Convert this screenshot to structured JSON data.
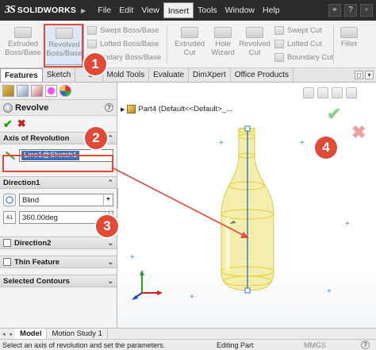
{
  "app": {
    "brand": "SOLIDWORKS",
    "brand_mark": "3S",
    "menus": [
      "File",
      "Edit",
      "View",
      "Insert",
      "Tools",
      "Window",
      "Help"
    ],
    "active_menu": "Insert",
    "help_glyph": "?",
    "window_glyph": "▫"
  },
  "ribbon": {
    "extruded_boss": "Extruded\nBoss/Base",
    "revolved_boss": "Revolved\nBoss/Base",
    "swept_boss": "Swept Boss/Base",
    "lofted_boss": "Lofted Boss/Base",
    "boundary_boss": "undary Boss/Base",
    "extruded_cut": "Extruded\nCut",
    "hole_wizard": "Hole\nWizard",
    "revolved_cut": "Revolved\nCut",
    "swept_cut": "Swept Cut",
    "lofted_cut": "Lofted Cut",
    "boundary_cut": "Boundary Cut",
    "fillet": "Fillet"
  },
  "tabs": [
    "Features",
    "Sketch",
    "Su",
    "Mold Tools",
    "Evaluate",
    "DimXpert",
    "Office Products"
  ],
  "active_tab": "Features",
  "property_manager": {
    "title": "Revolve",
    "axis_group": "Axis of Revolution",
    "axis_value": "Line1@Sketch1",
    "direction1_group": "Direction1",
    "end_condition": "Blind",
    "angle_value": "360.00deg",
    "angle_icon_text": "A1",
    "direction2_group": "Direction2",
    "thin_feature_group": "Thin Feature",
    "selected_contours_group": "Selected Contours"
  },
  "viewport": {
    "tree_item": "Part4  (Default<<Default>_..."
  },
  "callouts": [
    "1",
    "2",
    "3",
    "4"
  ],
  "bottom_tabs": [
    "Model",
    "Motion Study 1"
  ],
  "active_bottom_tab": "Model",
  "status": {
    "message": "Select an axis of revolution and set the parameters.",
    "mode": "Editing Part",
    "units": "MMGS",
    "help": "?"
  },
  "colors": {
    "accent_red": "#e04a37",
    "selection_blue": "#3b6fc4",
    "body_yellow": "#f4eeaa",
    "ok_green": "#1c9a1c",
    "cancel_red": "#c42020"
  },
  "icons": [
    "revolve-icon",
    "ok-check-icon",
    "cancel-x-icon",
    "line-axis-icon",
    "reverse-direction-icon",
    "angle-icon",
    "part-icon",
    "triad-icon"
  ]
}
